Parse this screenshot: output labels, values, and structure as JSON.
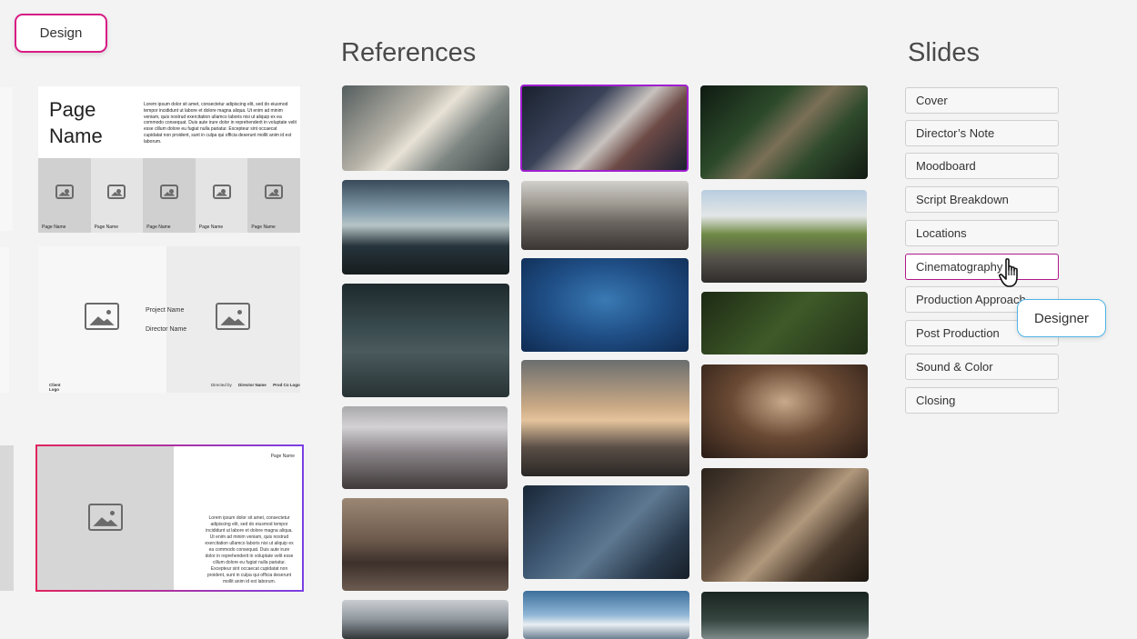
{
  "tags": {
    "design": "Design",
    "designer": "Designer"
  },
  "sections": {
    "references": "References",
    "slides": "Slides"
  },
  "slide_previews": {
    "s1": {
      "title_line1": "Page",
      "title_line2": "Name",
      "lorem": "Lorem ipsum dolor sit amet, consectetur adipiscing elit, sed do eiusmod tempor incididunt ut labore et dolore magna aliqua. Ut enim ad minim veniam, quis nostrud exercitation ullamco laboris nisi ut aliquip ex ea commodo consequat. Duis aute irure dolor in reprehenderit in voluptate velit esse cillum dolore eu fugiat nulla pariatur. Excepteur sint occaecat cupidatat non proident, sunt in culpa qui officia deserunt mollit anim id est laborum.",
      "cells": [
        "Page Name",
        "Page Name",
        "Page Name",
        "Page Name",
        "Page Name"
      ]
    },
    "s2": {
      "project": "Project Name",
      "director": "Director Name",
      "client_logo_1": "Client",
      "client_logo_2": "Logo",
      "directed_by": "Directed by",
      "director_name": "Director Name",
      "prod_co": "Prod Co Logo"
    },
    "s3": {
      "page_name": "Page Name",
      "body": "Lorem ipsum dolor sit amet, consectetur adipiscing elit, sed do eiusmod tempor incididunt ut labore et dolore magna aliqua. Ut enim ad minim veniam, quis nostrud exercitation ullamco laboris nisi ut aliquip ex ea commodo consequat. Duis aute irure dolor in reprehenderit in voluptate velit esse cillum dolore eu fugiat nulla pariatur. Excepteur sint occaecat cupidatat non proident, sunt in culpa qui officia deserunt mollit anim id est laborum."
    }
  },
  "slides_list": [
    "Cover",
    "Director’s Note",
    "Moodboard",
    "Script Breakdown",
    "Locations",
    "Cinematography",
    "Production Approach",
    "Post Production",
    "Sound & Color",
    "Closing"
  ],
  "active_slide": "Cinematography",
  "colors": {
    "selection_pink": "#d81b84",
    "selection_purple": "#a01fd0",
    "designer_blue": "#4fb3e8"
  },
  "icons": {
    "pointer": "hand-pointer-icon",
    "placeholder": "image-placeholder-icon"
  }
}
